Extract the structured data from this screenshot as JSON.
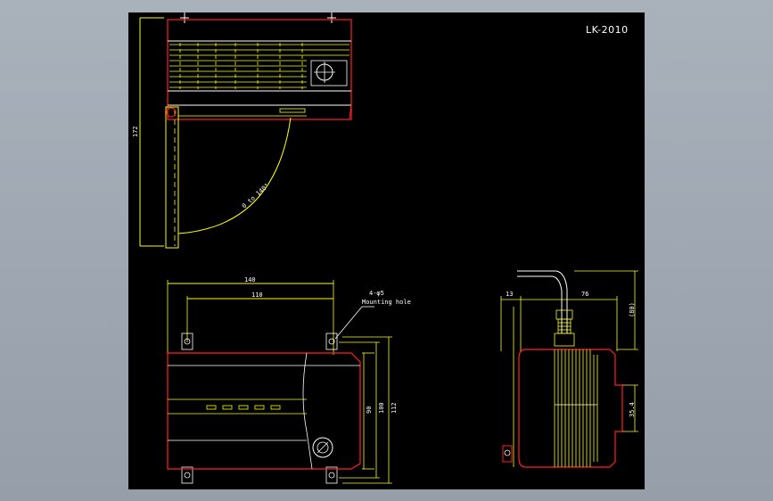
{
  "drawing": {
    "title": "LK-2010",
    "side_view": {
      "height_dim": "172",
      "swing_label": "0 to 140°"
    },
    "front_view": {
      "width_outer": "140",
      "width_inner": "110",
      "hole_note": "4-φ5",
      "hole_note_2": "Mounting hole",
      "height_90": "90",
      "height_100": "100",
      "height_112": "112"
    },
    "end_view": {
      "dim_13": "13",
      "dim_76": "76",
      "dim_80": "(80)",
      "dim_35": "35.4"
    },
    "colors": {
      "outline": "#ff2020",
      "dimension": "#ffff00",
      "text": "#ffffff",
      "background": "#000000"
    }
  }
}
